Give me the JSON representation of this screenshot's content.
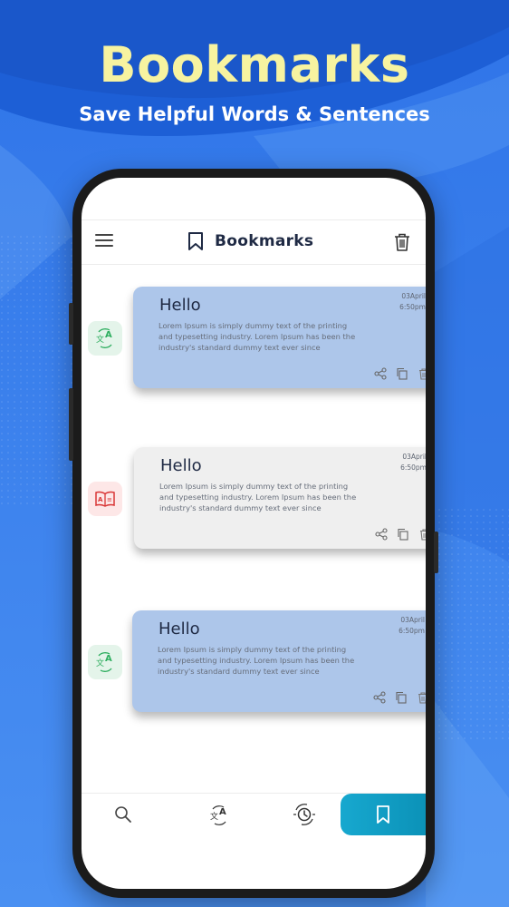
{
  "promo": {
    "title": "Bookmarks",
    "subtitle": "Save Helpful Words & Sentences"
  },
  "app": {
    "header": {
      "menu_icon": "hamburger-menu-icon",
      "bookmark_icon": "bookmark-icon",
      "title": "Bookmarks",
      "delete_icon": "trash-icon"
    },
    "cards": [
      {
        "type_icon": "translate-icon",
        "type_color": "#2eae5f",
        "style": "blue",
        "title": "Hello",
        "body": "Lorem Ipsum is simply dummy text of the printing and typesetting industry. Lorem Ipsum has been the industry's standard dummy text ever since",
        "date": "03April",
        "time": "6:50pm"
      },
      {
        "type_icon": "dictionary-book-icon",
        "type_color": "#d93636",
        "style": "grey",
        "title": "Hello",
        "body": "Lorem Ipsum is simply dummy text of the printing and typesetting industry. Lorem Ipsum has been the industry's standard dummy text ever since",
        "date": "03April",
        "time": "6:50pm"
      },
      {
        "type_icon": "translate-icon",
        "type_color": "#2eae5f",
        "style": "blue",
        "title": "Hello",
        "body": "Lorem Ipsum is simply dummy text of the printing and typesetting industry. Lorem Ipsum has been the industry's standard dummy text ever since",
        "date": "03April",
        "time": "6:50pm"
      }
    ],
    "bottom_nav": [
      {
        "icon": "search-icon",
        "active": false
      },
      {
        "icon": "translate-icon",
        "active": false
      },
      {
        "icon": "history-icon",
        "active": false
      },
      {
        "icon": "bookmark-icon",
        "active": true
      }
    ],
    "colors": {
      "accent": "#0fa0c6",
      "card_blue": "#adc6ea",
      "card_grey": "#efefef",
      "title_yellow": "#f7f3a0",
      "background_blue": "#3f86f0"
    }
  }
}
